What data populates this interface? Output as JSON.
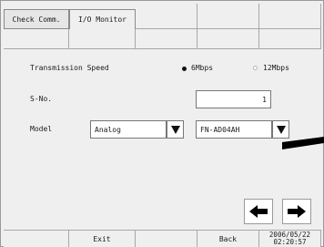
{
  "tabs": [
    {
      "label": "Check Comm."
    },
    {
      "label": "I/O Monitor"
    }
  ],
  "transmission_speed": {
    "label": "Transmission Speed",
    "options": [
      {
        "label": "6Mbps",
        "selected": true
      },
      {
        "label": "12Mbps",
        "selected": false
      }
    ]
  },
  "s_no": {
    "label": "S-No.",
    "value": "1"
  },
  "model": {
    "label": "Model",
    "type_value": "Analog",
    "unit_value": "FN-AD04AH"
  },
  "footer": {
    "exit_label": "Exit",
    "back_label": "Back",
    "date": "2006/05/22",
    "time": "02:20:57"
  },
  "icons": {
    "dropdown": "triangle-down-icon",
    "prev": "arrow-left-icon",
    "next": "arrow-right-icon"
  }
}
